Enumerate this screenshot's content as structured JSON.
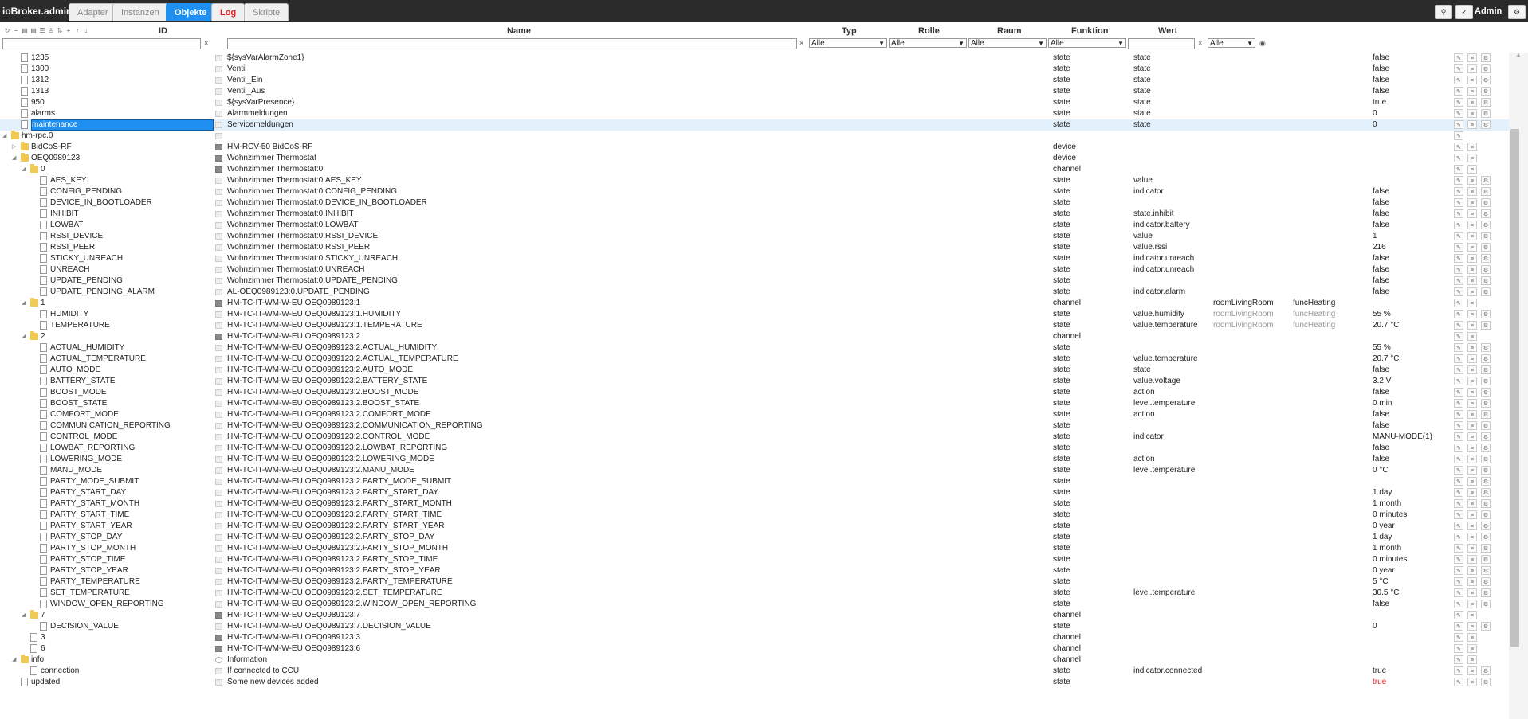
{
  "app": {
    "brand": "ioBroker.admin",
    "tabs": [
      "Adapter",
      "Instanzen",
      "Objekte",
      "Log",
      "Skripte"
    ],
    "active_tab": "Objekte",
    "user": "Admin"
  },
  "columns": {
    "id": "ID",
    "name": "Name",
    "type": "Typ",
    "role": "Rolle",
    "room": "Raum",
    "function": "Funktion",
    "value": "Wert"
  },
  "filters": {
    "type": "Alle",
    "role": "Alle",
    "room": "Alle",
    "function": "Alle",
    "value": "Alle"
  },
  "colors": {
    "accent": "#1f8ff0",
    "topbar": "#2b2b2b",
    "log": "#e0201e",
    "folder": "#f1c851"
  },
  "rows": [
    {
      "id": "1235",
      "name": "${sysVarAlarmZone1}",
      "type": "state",
      "role": "state",
      "room": "",
      "func": "",
      "value": "false",
      "icon": "file",
      "ni": "std",
      "lv": 1,
      "toggle": "",
      "acts": 3
    },
    {
      "id": "1300",
      "name": "Ventil",
      "type": "state",
      "role": "state",
      "room": "",
      "func": "",
      "value": "false",
      "icon": "file",
      "ni": "std",
      "lv": 1,
      "toggle": "",
      "acts": 3
    },
    {
      "id": "1312",
      "name": "Ventil_Ein",
      "type": "state",
      "role": "state",
      "room": "",
      "func": "",
      "value": "false",
      "icon": "file",
      "ni": "std",
      "lv": 1,
      "toggle": "",
      "acts": 3
    },
    {
      "id": "1313",
      "name": "Ventil_Aus",
      "type": "state",
      "role": "state",
      "room": "",
      "func": "",
      "value": "false",
      "icon": "file",
      "ni": "std",
      "lv": 1,
      "toggle": "",
      "acts": 3
    },
    {
      "id": "950",
      "name": "${sysVarPresence}",
      "type": "state",
      "role": "state",
      "room": "",
      "func": "",
      "value": "true",
      "icon": "file",
      "ni": "std",
      "lv": 1,
      "toggle": "",
      "acts": 3
    },
    {
      "id": "alarms",
      "name": "Alarmmeldungen",
      "type": "state",
      "role": "state",
      "room": "",
      "func": "",
      "value": "0",
      "icon": "file",
      "ni": "std",
      "lv": 1,
      "toggle": "",
      "acts": 3
    },
    {
      "id": "maintenance",
      "name": "Servicemeldungen",
      "type": "state",
      "role": "state",
      "room": "",
      "func": "",
      "value": "0",
      "icon": "file",
      "ni": "std",
      "lv": 1,
      "toggle": "",
      "acts": 3,
      "selected": true
    },
    {
      "id": "hm-rpc.0",
      "name": "",
      "type": "",
      "role": "",
      "room": "",
      "func": "",
      "value": "",
      "icon": "folder",
      "ni": "std",
      "lv": 0,
      "toggle": "open",
      "acts": 1
    },
    {
      "id": "BidCoS-RF",
      "name": "HM-RCV-50 BidCoS-RF",
      "type": "device",
      "role": "",
      "room": "",
      "func": "",
      "value": "",
      "icon": "folder",
      "ni": "dev",
      "lv": 1,
      "toggle": "closed",
      "acts": 2
    },
    {
      "id": "OEQ0989123",
      "name": "Wohnzimmer Thermostat",
      "type": "device",
      "role": "",
      "room": "",
      "func": "",
      "value": "",
      "icon": "folder",
      "ni": "dev",
      "lv": 1,
      "toggle": "open",
      "acts": 2
    },
    {
      "id": "0",
      "name": "Wohnzimmer Thermostat:0",
      "type": "channel",
      "role": "",
      "room": "",
      "func": "",
      "value": "",
      "icon": "folder",
      "ni": "dev",
      "lv": 2,
      "toggle": "open",
      "acts": 2
    },
    {
      "id": "AES_KEY",
      "name": "Wohnzimmer Thermostat:0.AES_KEY",
      "type": "state",
      "role": "value",
      "room": "",
      "func": "",
      "value": "",
      "icon": "file",
      "ni": "std",
      "lv": 3,
      "toggle": "",
      "acts": 3
    },
    {
      "id": "CONFIG_PENDING",
      "name": "Wohnzimmer Thermostat:0.CONFIG_PENDING",
      "type": "state",
      "role": "indicator",
      "room": "",
      "func": "",
      "value": "false",
      "icon": "file",
      "ni": "std",
      "lv": 3,
      "toggle": "",
      "acts": 3
    },
    {
      "id": "DEVICE_IN_BOOTLOADER",
      "name": "Wohnzimmer Thermostat:0.DEVICE_IN_BOOTLOADER",
      "type": "state",
      "role": "",
      "room": "",
      "func": "",
      "value": "false",
      "icon": "file",
      "ni": "std",
      "lv": 3,
      "toggle": "",
      "acts": 3
    },
    {
      "id": "INHIBIT",
      "name": "Wohnzimmer Thermostat:0.INHIBIT",
      "type": "state",
      "role": "state.inhibit",
      "room": "",
      "func": "",
      "value": "false",
      "icon": "file",
      "ni": "std",
      "lv": 3,
      "toggle": "",
      "acts": 3
    },
    {
      "id": "LOWBAT",
      "name": "Wohnzimmer Thermostat:0.LOWBAT",
      "type": "state",
      "role": "indicator.battery",
      "room": "",
      "func": "",
      "value": "false",
      "icon": "file",
      "ni": "std",
      "lv": 3,
      "toggle": "",
      "acts": 3
    },
    {
      "id": "RSSI_DEVICE",
      "name": "Wohnzimmer Thermostat:0.RSSI_DEVICE",
      "type": "state",
      "role": "value",
      "room": "",
      "func": "",
      "value": "1",
      "icon": "file",
      "ni": "std",
      "lv": 3,
      "toggle": "",
      "acts": 3
    },
    {
      "id": "RSSI_PEER",
      "name": "Wohnzimmer Thermostat:0.RSSI_PEER",
      "type": "state",
      "role": "value.rssi",
      "room": "",
      "func": "",
      "value": "216",
      "icon": "file",
      "ni": "std",
      "lv": 3,
      "toggle": "",
      "acts": 3
    },
    {
      "id": "STICKY_UNREACH",
      "name": "Wohnzimmer Thermostat:0.STICKY_UNREACH",
      "type": "state",
      "role": "indicator.unreach",
      "room": "",
      "func": "",
      "value": "false",
      "icon": "file",
      "ni": "std",
      "lv": 3,
      "toggle": "",
      "acts": 3
    },
    {
      "id": "UNREACH",
      "name": "Wohnzimmer Thermostat:0.UNREACH",
      "type": "state",
      "role": "indicator.unreach",
      "room": "",
      "func": "",
      "value": "false",
      "icon": "file",
      "ni": "std",
      "lv": 3,
      "toggle": "",
      "acts": 3
    },
    {
      "id": "UPDATE_PENDING",
      "name": "Wohnzimmer Thermostat:0.UPDATE_PENDING",
      "type": "state",
      "role": "",
      "room": "",
      "func": "",
      "value": "false",
      "icon": "file",
      "ni": "std",
      "lv": 3,
      "toggle": "",
      "acts": 3
    },
    {
      "id": "UPDATE_PENDING_ALARM",
      "name": "AL-OEQ0989123:0.UPDATE_PENDING",
      "type": "state",
      "role": "indicator.alarm",
      "room": "",
      "func": "",
      "value": "false",
      "icon": "file",
      "ni": "std",
      "lv": 3,
      "toggle": "",
      "acts": 3
    },
    {
      "id": "1",
      "name": "HM-TC-IT-WM-W-EU OEQ0989123:1",
      "type": "channel",
      "role": "",
      "room": "roomLivingRoom",
      "func": "funcHeating",
      "value": "",
      "icon": "folder",
      "ni": "dev",
      "lv": 2,
      "toggle": "open",
      "acts": 2,
      "rf": "dark"
    },
    {
      "id": "HUMIDITY",
      "name": "HM-TC-IT-WM-W-EU OEQ0989123:1.HUMIDITY",
      "type": "state",
      "role": "value.humidity",
      "room": "roomLivingRoom",
      "func": "funcHeating",
      "value": "55 %",
      "icon": "file",
      "ni": "std",
      "lv": 3,
      "toggle": "",
      "acts": 3,
      "rf": "gray"
    },
    {
      "id": "TEMPERATURE",
      "name": "HM-TC-IT-WM-W-EU OEQ0989123:1.TEMPERATURE",
      "type": "state",
      "role": "value.temperature",
      "room": "roomLivingRoom",
      "func": "funcHeating",
      "value": "20.7 °C",
      "icon": "file",
      "ni": "std",
      "lv": 3,
      "toggle": "",
      "acts": 3,
      "rf": "gray"
    },
    {
      "id": "2",
      "name": "HM-TC-IT-WM-W-EU OEQ0989123:2",
      "type": "channel",
      "role": "",
      "room": "",
      "func": "",
      "value": "",
      "icon": "folder",
      "ni": "dev",
      "lv": 2,
      "toggle": "open",
      "acts": 2
    },
    {
      "id": "ACTUAL_HUMIDITY",
      "name": "HM-TC-IT-WM-W-EU OEQ0989123:2.ACTUAL_HUMIDITY",
      "type": "state",
      "role": "",
      "room": "",
      "func": "",
      "value": "55 %",
      "icon": "file",
      "ni": "std",
      "lv": 3,
      "toggle": "",
      "acts": 3
    },
    {
      "id": "ACTUAL_TEMPERATURE",
      "name": "HM-TC-IT-WM-W-EU OEQ0989123:2.ACTUAL_TEMPERATURE",
      "type": "state",
      "role": "value.temperature",
      "room": "",
      "func": "",
      "value": "20.7 °C",
      "icon": "file",
      "ni": "std",
      "lv": 3,
      "toggle": "",
      "acts": 3
    },
    {
      "id": "AUTO_MODE",
      "name": "HM-TC-IT-WM-W-EU OEQ0989123:2.AUTO_MODE",
      "type": "state",
      "role": "state",
      "room": "",
      "func": "",
      "value": "false",
      "icon": "file",
      "ni": "std",
      "lv": 3,
      "toggle": "",
      "acts": 3
    },
    {
      "id": "BATTERY_STATE",
      "name": "HM-TC-IT-WM-W-EU OEQ0989123:2.BATTERY_STATE",
      "type": "state",
      "role": "value.voltage",
      "room": "",
      "func": "",
      "value": "3.2 V",
      "icon": "file",
      "ni": "std",
      "lv": 3,
      "toggle": "",
      "acts": 3
    },
    {
      "id": "BOOST_MODE",
      "name": "HM-TC-IT-WM-W-EU OEQ0989123:2.BOOST_MODE",
      "type": "state",
      "role": "action",
      "room": "",
      "func": "",
      "value": "false",
      "icon": "file",
      "ni": "std",
      "lv": 3,
      "toggle": "",
      "acts": 3
    },
    {
      "id": "BOOST_STATE",
      "name": "HM-TC-IT-WM-W-EU OEQ0989123:2.BOOST_STATE",
      "type": "state",
      "role": "level.temperature",
      "room": "",
      "func": "",
      "value": "0 min",
      "icon": "file",
      "ni": "std",
      "lv": 3,
      "toggle": "",
      "acts": 3
    },
    {
      "id": "COMFORT_MODE",
      "name": "HM-TC-IT-WM-W-EU OEQ0989123:2.COMFORT_MODE",
      "type": "state",
      "role": "action",
      "room": "",
      "func": "",
      "value": "false",
      "icon": "file",
      "ni": "std",
      "lv": 3,
      "toggle": "",
      "acts": 3
    },
    {
      "id": "COMMUNICATION_REPORTING",
      "name": "HM-TC-IT-WM-W-EU OEQ0989123:2.COMMUNICATION_REPORTING",
      "type": "state",
      "role": "",
      "room": "",
      "func": "",
      "value": "false",
      "icon": "file",
      "ni": "std",
      "lv": 3,
      "toggle": "",
      "acts": 3
    },
    {
      "id": "CONTROL_MODE",
      "name": "HM-TC-IT-WM-W-EU OEQ0989123:2.CONTROL_MODE",
      "type": "state",
      "role": "indicator",
      "room": "",
      "func": "",
      "value": "MANU-MODE(1)",
      "icon": "file",
      "ni": "std",
      "lv": 3,
      "toggle": "",
      "acts": 3
    },
    {
      "id": "LOWBAT_REPORTING",
      "name": "HM-TC-IT-WM-W-EU OEQ0989123:2.LOWBAT_REPORTING",
      "type": "state",
      "role": "",
      "room": "",
      "func": "",
      "value": "false",
      "icon": "file",
      "ni": "std",
      "lv": 3,
      "toggle": "",
      "acts": 3
    },
    {
      "id": "LOWERING_MODE",
      "name": "HM-TC-IT-WM-W-EU OEQ0989123:2.LOWERING_MODE",
      "type": "state",
      "role": "action",
      "room": "",
      "func": "",
      "value": "false",
      "icon": "file",
      "ni": "std",
      "lv": 3,
      "toggle": "",
      "acts": 3
    },
    {
      "id": "MANU_MODE",
      "name": "HM-TC-IT-WM-W-EU OEQ0989123:2.MANU_MODE",
      "type": "state",
      "role": "level.temperature",
      "room": "",
      "func": "",
      "value": "0 °C",
      "icon": "file",
      "ni": "std",
      "lv": 3,
      "toggle": "",
      "acts": 3
    },
    {
      "id": "PARTY_MODE_SUBMIT",
      "name": "HM-TC-IT-WM-W-EU OEQ0989123:2.PARTY_MODE_SUBMIT",
      "type": "state",
      "role": "",
      "room": "",
      "func": "",
      "value": "",
      "icon": "file",
      "ni": "std",
      "lv": 3,
      "toggle": "",
      "acts": 3
    },
    {
      "id": "PARTY_START_DAY",
      "name": "HM-TC-IT-WM-W-EU OEQ0989123:2.PARTY_START_DAY",
      "type": "state",
      "role": "",
      "room": "",
      "func": "",
      "value": "1 day",
      "icon": "file",
      "ni": "std",
      "lv": 3,
      "toggle": "",
      "acts": 3
    },
    {
      "id": "PARTY_START_MONTH",
      "name": "HM-TC-IT-WM-W-EU OEQ0989123:2.PARTY_START_MONTH",
      "type": "state",
      "role": "",
      "room": "",
      "func": "",
      "value": "1 month",
      "icon": "file",
      "ni": "std",
      "lv": 3,
      "toggle": "",
      "acts": 3
    },
    {
      "id": "PARTY_START_TIME",
      "name": "HM-TC-IT-WM-W-EU OEQ0989123:2.PARTY_START_TIME",
      "type": "state",
      "role": "",
      "room": "",
      "func": "",
      "value": "0 minutes",
      "icon": "file",
      "ni": "std",
      "lv": 3,
      "toggle": "",
      "acts": 3
    },
    {
      "id": "PARTY_START_YEAR",
      "name": "HM-TC-IT-WM-W-EU OEQ0989123:2.PARTY_START_YEAR",
      "type": "state",
      "role": "",
      "room": "",
      "func": "",
      "value": "0 year",
      "icon": "file",
      "ni": "std",
      "lv": 3,
      "toggle": "",
      "acts": 3
    },
    {
      "id": "PARTY_STOP_DAY",
      "name": "HM-TC-IT-WM-W-EU OEQ0989123:2.PARTY_STOP_DAY",
      "type": "state",
      "role": "",
      "room": "",
      "func": "",
      "value": "1 day",
      "icon": "file",
      "ni": "std",
      "lv": 3,
      "toggle": "",
      "acts": 3
    },
    {
      "id": "PARTY_STOP_MONTH",
      "name": "HM-TC-IT-WM-W-EU OEQ0989123:2.PARTY_STOP_MONTH",
      "type": "state",
      "role": "",
      "room": "",
      "func": "",
      "value": "1 month",
      "icon": "file",
      "ni": "std",
      "lv": 3,
      "toggle": "",
      "acts": 3
    },
    {
      "id": "PARTY_STOP_TIME",
      "name": "HM-TC-IT-WM-W-EU OEQ0989123:2.PARTY_STOP_TIME",
      "type": "state",
      "role": "",
      "room": "",
      "func": "",
      "value": "0 minutes",
      "icon": "file",
      "ni": "std",
      "lv": 3,
      "toggle": "",
      "acts": 3
    },
    {
      "id": "PARTY_STOP_YEAR",
      "name": "HM-TC-IT-WM-W-EU OEQ0989123:2.PARTY_STOP_YEAR",
      "type": "state",
      "role": "",
      "room": "",
      "func": "",
      "value": "0 year",
      "icon": "file",
      "ni": "std",
      "lv": 3,
      "toggle": "",
      "acts": 3
    },
    {
      "id": "PARTY_TEMPERATURE",
      "name": "HM-TC-IT-WM-W-EU OEQ0989123:2.PARTY_TEMPERATURE",
      "type": "state",
      "role": "",
      "room": "",
      "func": "",
      "value": "5 °C",
      "icon": "file",
      "ni": "std",
      "lv": 3,
      "toggle": "",
      "acts": 3
    },
    {
      "id": "SET_TEMPERATURE",
      "name": "HM-TC-IT-WM-W-EU OEQ0989123:2.SET_TEMPERATURE",
      "type": "state",
      "role": "level.temperature",
      "room": "",
      "func": "",
      "value": "30.5 °C",
      "icon": "file",
      "ni": "std",
      "lv": 3,
      "toggle": "",
      "acts": 3
    },
    {
      "id": "WINDOW_OPEN_REPORTING",
      "name": "HM-TC-IT-WM-W-EU OEQ0989123:2.WINDOW_OPEN_REPORTING",
      "type": "state",
      "role": "",
      "room": "",
      "func": "",
      "value": "false",
      "icon": "file",
      "ni": "std",
      "lv": 3,
      "toggle": "",
      "acts": 3
    },
    {
      "id": "7",
      "name": "HM-TC-IT-WM-W-EU OEQ0989123:7",
      "type": "channel",
      "role": "",
      "room": "",
      "func": "",
      "value": "",
      "icon": "folder",
      "ni": "dev",
      "lv": 2,
      "toggle": "open",
      "acts": 2
    },
    {
      "id": "DECISION_VALUE",
      "name": "HM-TC-IT-WM-W-EU OEQ0989123:7.DECISION_VALUE",
      "type": "state",
      "role": "",
      "room": "",
      "func": "",
      "value": "0",
      "icon": "file",
      "ni": "std",
      "lv": 3,
      "toggle": "",
      "acts": 3
    },
    {
      "id": "3",
      "name": "HM-TC-IT-WM-W-EU OEQ0989123:3",
      "type": "channel",
      "role": "",
      "room": "",
      "func": "",
      "value": "",
      "icon": "file",
      "ni": "dev",
      "lv": 2,
      "toggle": "",
      "acts": 2
    },
    {
      "id": "6",
      "name": "HM-TC-IT-WM-W-EU OEQ0989123:6",
      "type": "channel",
      "role": "",
      "room": "",
      "func": "",
      "value": "",
      "icon": "file",
      "ni": "dev",
      "lv": 2,
      "toggle": "",
      "acts": 2
    },
    {
      "id": "info",
      "name": "Information",
      "type": "channel",
      "role": "",
      "room": "",
      "func": "",
      "value": "",
      "icon": "folder",
      "ni": "info",
      "lv": 1,
      "toggle": "open",
      "acts": 2
    },
    {
      "id": "connection",
      "name": "If connected to CCU",
      "type": "state",
      "role": "indicator.connected",
      "room": "",
      "func": "",
      "value": "true",
      "icon": "file",
      "ni": "std",
      "lv": 2,
      "toggle": "",
      "acts": 3
    },
    {
      "id": "updated",
      "name": "Some new devices added",
      "type": "state",
      "role": "",
      "room": "",
      "func": "",
      "value": "true",
      "icon": "file",
      "ni": "std",
      "lv": 1,
      "toggle": "",
      "acts": 3,
      "vc": "red"
    }
  ]
}
